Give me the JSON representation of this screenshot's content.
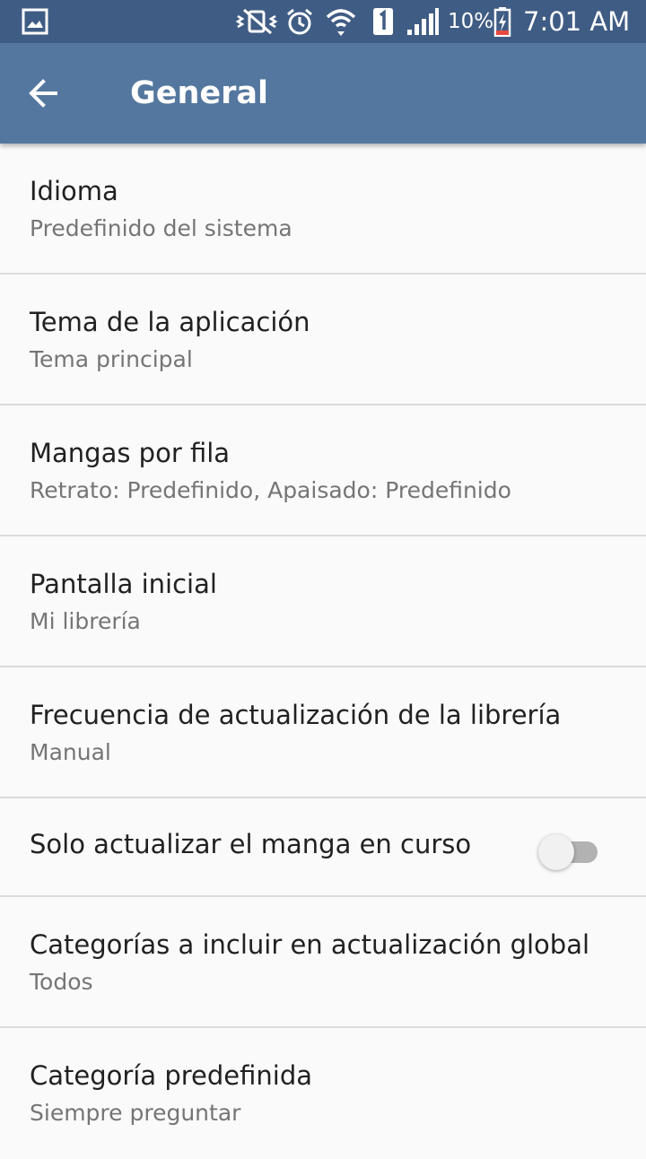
{
  "status_bar": {
    "icons": [
      "gallery-icon",
      "vibrate-mute-icon",
      "alarm-icon",
      "wifi-icon",
      "sim-1-icon",
      "signal-icon",
      "battery-charging-icon"
    ],
    "battery": "10%",
    "time": "7:01 AM"
  },
  "app_bar": {
    "back_icon": "arrow-back-icon",
    "title": "General"
  },
  "colors": {
    "status_bar": "#3f5c84",
    "app_bar": "#54779f",
    "background": "#fafafa",
    "divider": "#dcdcdc"
  },
  "settings": [
    {
      "title": "Idioma",
      "summary": "Predefinido del sistema"
    },
    {
      "title": "Tema de la aplicación",
      "summary": "Tema principal"
    },
    {
      "title": "Mangas por fila",
      "summary": "Retrato: Predefinido, Apaisado: Predefinido"
    },
    {
      "title": "Pantalla inicial",
      "summary": "Mi librería"
    },
    {
      "title": "Frecuencia de actualización de la librería",
      "summary": "Manual"
    },
    {
      "title": "Solo actualizar el manga en curso",
      "toggle": false
    },
    {
      "title": "Categorías a incluir en actualización global",
      "summary": "Todos"
    },
    {
      "title": "Categoría predefinida",
      "summary": "Siempre preguntar"
    }
  ]
}
